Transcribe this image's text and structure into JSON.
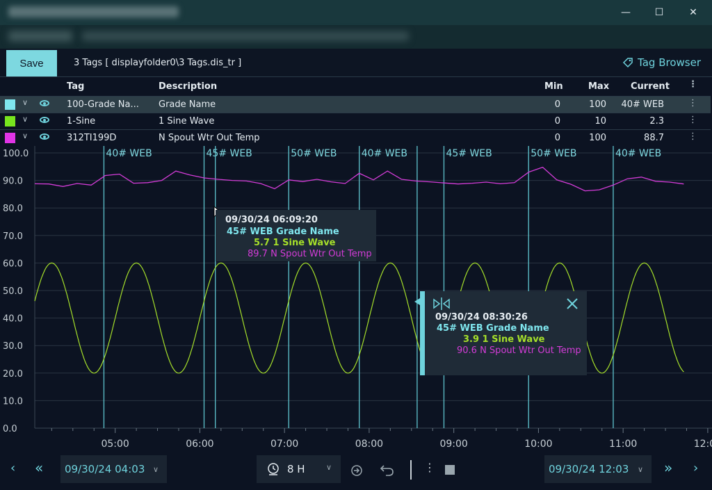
{
  "window": {
    "controls": {
      "minimize": "—",
      "maximize": "☐",
      "close": "✕"
    }
  },
  "toolbar": {
    "save_label": "Save",
    "file_title": "3 Tags [ displayfolder0\\3 Tags.dis_tr ]",
    "tag_browser_label": "Tag Browser"
  },
  "grid": {
    "headers": {
      "tag": "Tag",
      "description": "Description",
      "min": "Min",
      "max": "Max",
      "current": "Current"
    },
    "rows": [
      {
        "color": "#7fe6ee",
        "tag": "100-Grade Na...",
        "description": "Grade Name",
        "min": "0",
        "max": "100",
        "current": "40# WEB",
        "selected": true
      },
      {
        "color": "#78e61e",
        "tag": "1-Sine",
        "description": "1 Sine Wave",
        "min": "0",
        "max": "10",
        "current": "2.3",
        "selected": false
      },
      {
        "color": "#e034e6",
        "tag": "312TI199D",
        "description": "N Spout Wtr Out Temp",
        "min": "0",
        "max": "100",
        "current": "88.7",
        "selected": false
      }
    ]
  },
  "chart_data": {
    "type": "line",
    "ylim": [
      0,
      100
    ],
    "yticks": [
      "100.0",
      "90.0",
      "80.0",
      "70.0",
      "60.0",
      "50.0",
      "40.0",
      "30.0",
      "20.0",
      "10.0",
      "0.0"
    ],
    "xticks": [
      "05:00",
      "06:00",
      "07:00",
      "08:00",
      "09:00",
      "10:00",
      "11:00",
      "12:00"
    ],
    "x_range": [
      "09/30/24 04:03",
      "09/30/24 12:03"
    ],
    "grade_changes": [
      {
        "time": "04:52",
        "label": "40# WEB"
      },
      {
        "time": "06:03",
        "label": "45# WEB"
      },
      {
        "time": "06:11",
        "label": ""
      },
      {
        "time": "07:03",
        "label": "50# WEB"
      },
      {
        "time": "07:53",
        "label": "40# WEB"
      },
      {
        "time": "08:34",
        "label": ""
      },
      {
        "time": "08:53",
        "label": "45# WEB"
      },
      {
        "time": "09:53",
        "label": "50# WEB"
      },
      {
        "time": "10:53",
        "label": "40# WEB"
      }
    ],
    "series": [
      {
        "name": "1 Sine Wave",
        "color": "#a6e02a",
        "period_minutes": 60,
        "min": 20,
        "max": 60,
        "peak_times": [
          "04:15",
          "05:15",
          "06:15",
          "07:15",
          "08:15",
          "09:15",
          "10:15",
          "11:15"
        ],
        "end_time": "11:43"
      },
      {
        "name": "N Spout Wtr Out Temp",
        "color": "#d43cd8",
        "x": [
          "04:03",
          "04:13",
          "04:23",
          "04:33",
          "04:43",
          "04:53",
          "05:03",
          "05:13",
          "05:23",
          "05:33",
          "05:43",
          "05:53",
          "06:03",
          "06:13",
          "06:23",
          "06:33",
          "06:43",
          "06:53",
          "07:03",
          "07:13",
          "07:23",
          "07:33",
          "07:43",
          "07:53",
          "08:03",
          "08:13",
          "08:23",
          "08:33",
          "08:43",
          "08:53",
          "09:03",
          "09:13",
          "09:23",
          "09:33",
          "09:43",
          "09:53",
          "10:03",
          "10:13",
          "10:23",
          "10:33",
          "10:43",
          "10:53",
          "11:03",
          "11:13",
          "11:23",
          "11:33",
          "11:43"
        ],
        "values": [
          88.8,
          88.7,
          87.8,
          88.9,
          88.3,
          91.8,
          92.3,
          89.0,
          89.2,
          90.0,
          93.4,
          92.0,
          90.9,
          90.4,
          90.0,
          89.8,
          88.9,
          87.0,
          90.2,
          89.6,
          90.4,
          89.5,
          88.9,
          92.6,
          90.2,
          93.4,
          90.4,
          89.8,
          89.5,
          89.1,
          88.7,
          89.0,
          89.4,
          88.8,
          89.2,
          93.0,
          94.8,
          90.2,
          88.6,
          86.2,
          86.6,
          88.3,
          90.6,
          91.2,
          89.7,
          89.4,
          88.7
        ]
      }
    ]
  },
  "tooltips": [
    {
      "time": "09/30/24 06:09:20",
      "grade": "45# WEB Grade Name",
      "sine": "5.7 1 Sine Wave",
      "temp": "89.7 N Spout Wtr Out Temp"
    },
    {
      "time": "09/30/24 08:30:26",
      "grade": "45# WEB Grade Name",
      "sine": "3.9 1 Sine Wave",
      "temp": "90.6 N Spout Wtr Out Temp"
    }
  ],
  "bottom": {
    "start": "09/30/24 04:03",
    "end": "09/30/24 12:03",
    "span": "8 H",
    "prev": "‹",
    "rewind": "«",
    "forward": "»",
    "next": "›",
    "more": "⋮"
  }
}
